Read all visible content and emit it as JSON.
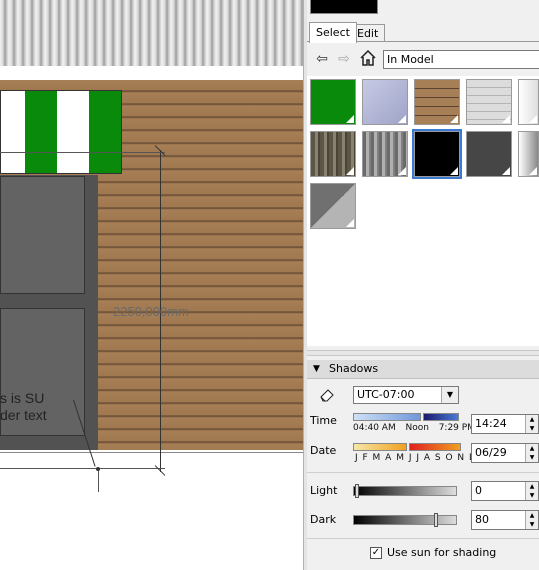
{
  "viewport": {
    "dimension_text": "2250,000mm",
    "leader_text": "s is SU\nder text"
  },
  "panel": {
    "tabs": [
      {
        "label": "Select"
      },
      {
        "label": "Edit"
      }
    ],
    "collection": "In Model",
    "swatches": [
      {
        "name": "green",
        "color": "#0a8a0a"
      },
      {
        "name": "lavender",
        "color": "#b7bbd9"
      },
      {
        "name": "wood-siding",
        "color": "#a07850"
      },
      {
        "name": "light-siding",
        "color": "#d4d4d4"
      },
      {
        "name": "white-gradient",
        "color": "#f2f2f2"
      },
      {
        "name": "rough-wood",
        "color": "#6d6655"
      },
      {
        "name": "gray-wood",
        "color": "#8a8a8a"
      },
      {
        "name": "black",
        "color": "#000000",
        "selected": true
      },
      {
        "name": "dark-gray",
        "color": "#464646"
      },
      {
        "name": "gray-gradient",
        "color": "#b0b0b0"
      },
      {
        "name": "split-gray",
        "color": "#8c8c8c"
      }
    ]
  },
  "shadows": {
    "title": "Shadows",
    "timezone": "UTC-07:00",
    "time_label": "Time",
    "time_bar_labels": [
      "04:40 AM",
      "Noon",
      "7:29 PM"
    ],
    "time_value": "14:24",
    "date_label": "Date",
    "date_bar_labels": "J F M A M J J A S O N D",
    "date_value": "06/29",
    "light_label": "Light",
    "light_value": "0",
    "dark_label": "Dark",
    "dark_value": "80",
    "use_sun_label": "Use sun for shading",
    "use_sun_checked": true
  }
}
